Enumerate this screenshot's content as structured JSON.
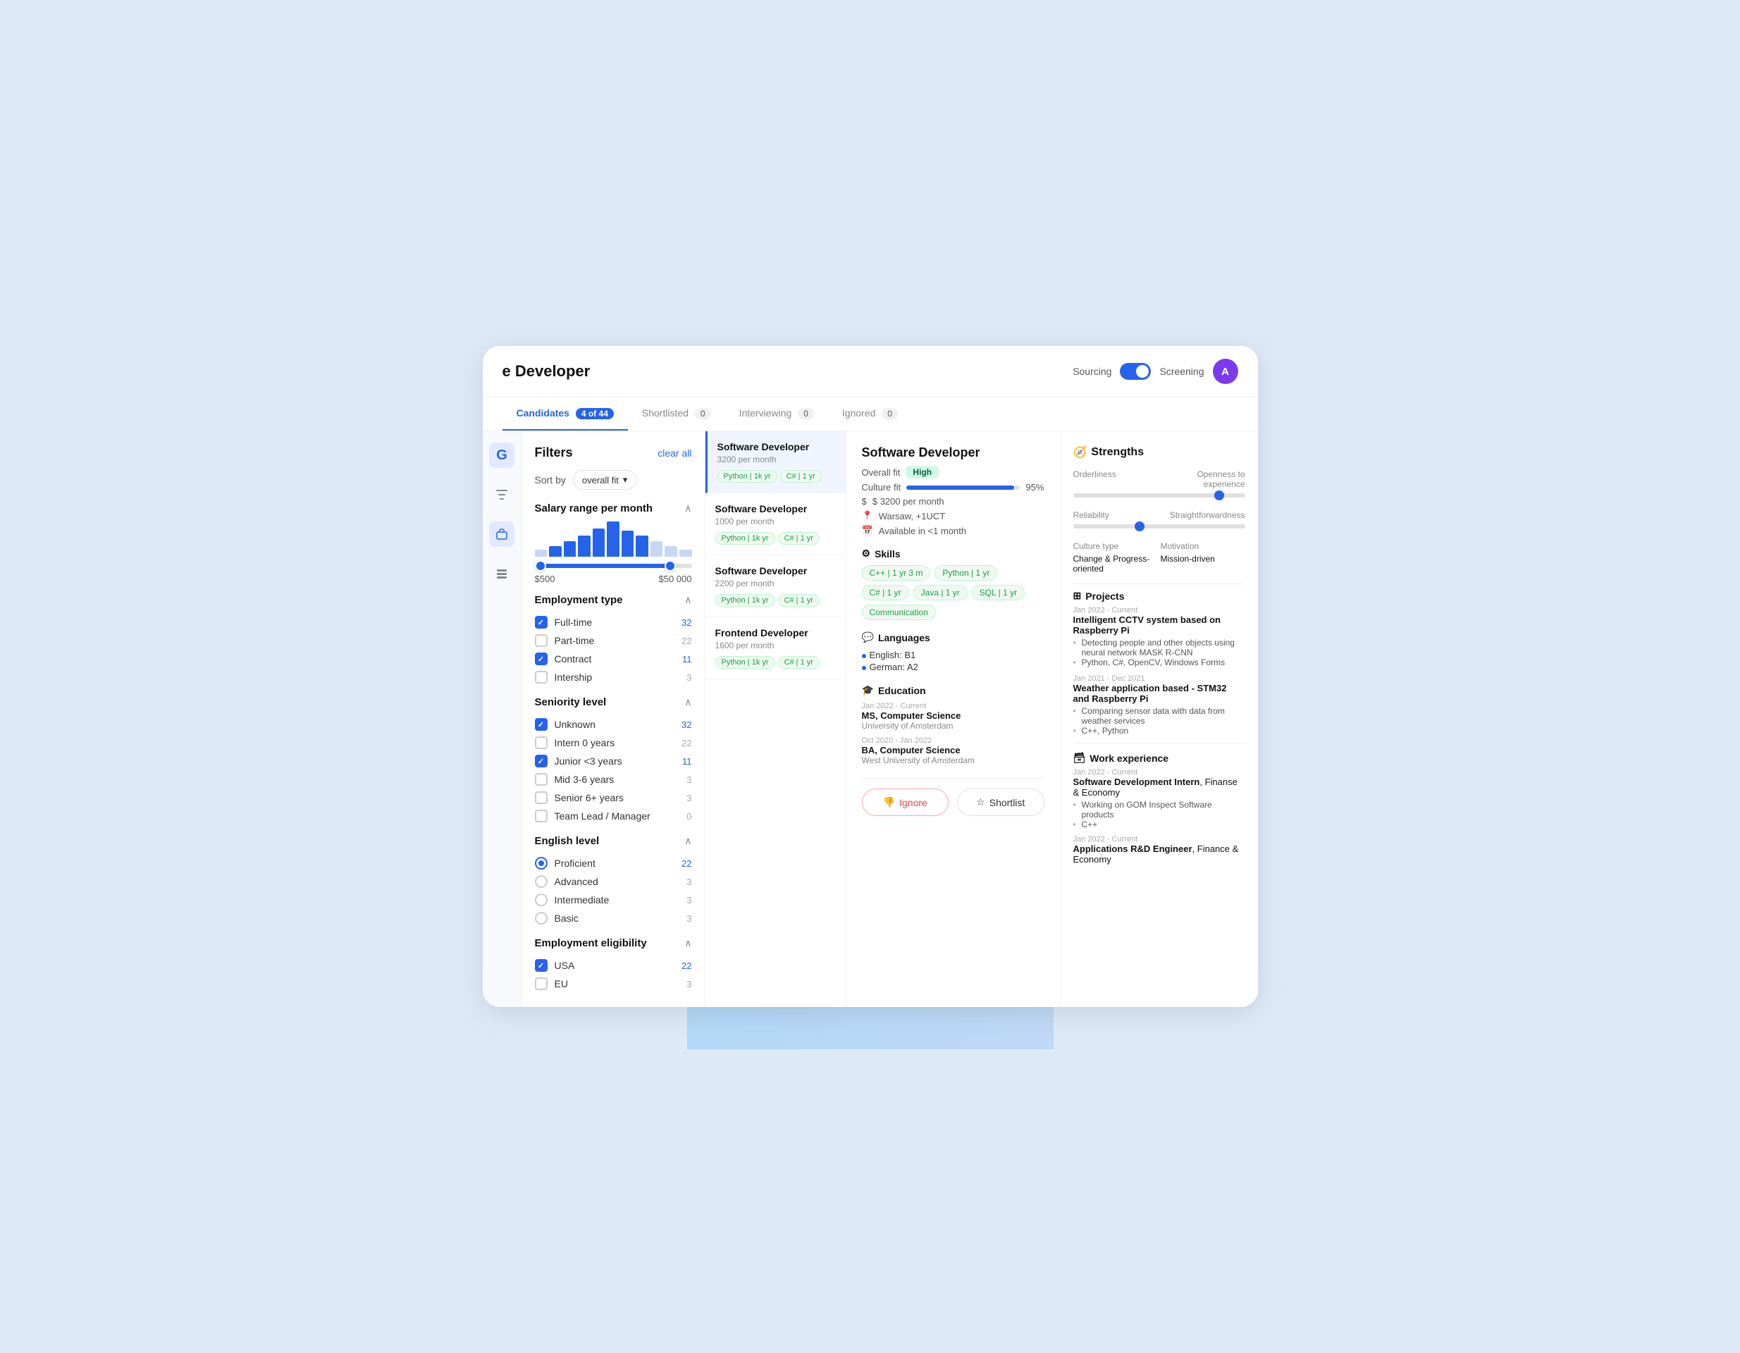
{
  "app": {
    "title": "e Developer",
    "sourcing_label": "Sourcing",
    "screening_label": "Screening",
    "avatar_letter": "A"
  },
  "tabs": [
    {
      "label": "tes",
      "badge": "4 of 44",
      "active": true
    },
    {
      "label": "Shortlisted",
      "badge": "0",
      "active": false
    },
    {
      "label": "Interviewing",
      "badge": "0",
      "active": false
    },
    {
      "label": "Ignored",
      "badge": "0",
      "active": false
    }
  ],
  "shortlisted_card": {
    "number": "0",
    "of_label": "of 44",
    "label": "Shortlisted"
  },
  "filters": {
    "title": "Filters",
    "clear_all": "clear all",
    "sort_by_label": "Sort by",
    "sort_by_value": "overall fit",
    "salary": {
      "section_title": "Salary range per month",
      "min": "$500",
      "max": "$50 000",
      "bars": [
        2,
        3,
        4,
        5,
        7,
        8,
        6,
        5,
        4,
        3,
        2
      ]
    },
    "employment_type": {
      "section_title": "Employment type",
      "items": [
        {
          "label": "Full-time",
          "count": "32",
          "checked": true
        },
        {
          "label": "Part-time",
          "count": "22",
          "checked": false
        },
        {
          "label": "Contract",
          "count": "11",
          "checked": true
        },
        {
          "label": "Intership",
          "count": "3",
          "checked": false
        }
      ]
    },
    "seniority_level": {
      "section_title": "Seniority level",
      "items": [
        {
          "label": "Unknown",
          "count": "32",
          "checked": true
        },
        {
          "label": "Intern 0 years",
          "count": "22",
          "checked": false
        },
        {
          "label": "Junior <3 years",
          "count": "11",
          "checked": true
        },
        {
          "label": "Mid 3-6 years",
          "count": "3",
          "checked": false
        },
        {
          "label": "Senior 6+ years",
          "count": "3",
          "checked": false
        },
        {
          "label": "Team Lead / Manager",
          "count": "0",
          "checked": false
        }
      ]
    },
    "english_level": {
      "section_title": "English level",
      "items": [
        {
          "label": "Proficient",
          "count": "22",
          "checked": true
        },
        {
          "label": "Advanced",
          "count": "3",
          "checked": false
        },
        {
          "label": "Intermediate",
          "count": "3",
          "checked": false
        },
        {
          "label": "Basic",
          "count": "3",
          "checked": false
        }
      ]
    },
    "employment_eligibility": {
      "section_title": "Employment eligibility",
      "items": [
        {
          "label": "USA",
          "count": "22",
          "checked": true
        },
        {
          "label": "EU",
          "count": "3",
          "checked": false
        }
      ]
    }
  },
  "candidates": [
    {
      "name": "Software Developer",
      "salary": "3200 per month",
      "skills": [
        "Python",
        "1k yr",
        "C#",
        "1 yr"
      ],
      "selected": true
    },
    {
      "name": "Software Developer",
      "salary": "1000 per month",
      "skills": [
        "Python",
        "1k yr",
        "C#",
        "1 yr"
      ],
      "selected": false
    },
    {
      "name": "Software Developer",
      "salary": "2200 per month",
      "skills": [
        "Python",
        "1k yr",
        "C#",
        "1 yr"
      ],
      "selected": false
    },
    {
      "name": "Frontend Developer",
      "salary": "1600 per month",
      "skills": [
        "Python",
        "1k yr",
        "C#",
        "1 yr"
      ],
      "selected": false
    }
  ],
  "detail": {
    "name": "Software Developer",
    "overall_fit": "High",
    "culture_fit_pct": 95,
    "salary": "$ 3200 per month",
    "location": "Warsaw, +1UCT",
    "availability": "Available in <1 month",
    "skills": [
      {
        "label": "C++",
        "duration": "1 yr 3 m"
      },
      {
        "label": "Python",
        "duration": "1 yr"
      },
      {
        "label": "C#",
        "duration": "1 yr"
      },
      {
        "label": "Java",
        "duration": "1 yr"
      },
      {
        "label": "SQL",
        "duration": "1 yr"
      },
      {
        "label": "Communication",
        "duration": ""
      }
    ],
    "languages": [
      {
        "label": "English: B1"
      },
      {
        "label": "German: A2"
      }
    ],
    "education": [
      {
        "date": "Jan 2022 - Current",
        "degree": "MS, Computer Science",
        "school": "University of Amsterdam"
      },
      {
        "date": "Oct 2020 - Jan 2022",
        "degree": "BA, Computer Science",
        "school": "West University of Amsterdam"
      }
    ],
    "buttons": {
      "ignore": "Ignore",
      "shortlist": "Shortlist"
    }
  },
  "strengths": {
    "title": "Strengths",
    "orderliness_label": "Orderliness",
    "openness_label": "Openness to experience",
    "reliability_label": "Reliability",
    "straightforwardness_label": "Straightforwardness",
    "orderliness_pct": 85,
    "reliability_pct": 40,
    "culture_type_label": "Culture type",
    "culture_type_val": "Change & Progress-oriented",
    "motivation_label": "Motivation",
    "motivation_val": "Mission-driven",
    "projects_title": "Projects",
    "projects": [
      {
        "date": "Jan 2022 - Current",
        "name": "Intelligent CCTV system based on Raspberry Pi",
        "bullets": [
          "Detecting people and other objects using neural network MASK R-CNN",
          "Python, C#, OpenCV, Windows Forms"
        ]
      },
      {
        "date": "Jan 2021 - Dec 2021",
        "name": "Weather application based - STM32 and Raspberry Pi",
        "bullets": [
          "Comparing sensor data with data from weather services",
          "C++, Python"
        ]
      }
    ],
    "work_title": "Work experience",
    "work_items": [
      {
        "date": "Jan 2022 - Current",
        "role": "Software Development Intern",
        "company": "Finanse & Economy",
        "bullets": [
          "Working on GOM Inspect Software products",
          "C++"
        ]
      },
      {
        "date": "Jan 2022 - Current",
        "role": "Applications R&D Engineer",
        "company": "Finance & Economy",
        "bullets": []
      }
    ]
  },
  "nav_icons": [
    {
      "name": "logo-icon",
      "symbol": "G",
      "active": true
    },
    {
      "name": "filter-icon",
      "symbol": "⊞",
      "active": false
    },
    {
      "name": "briefcase-icon",
      "symbol": "💼",
      "active": true
    },
    {
      "name": "list-icon",
      "symbol": "☰",
      "active": false
    }
  ]
}
